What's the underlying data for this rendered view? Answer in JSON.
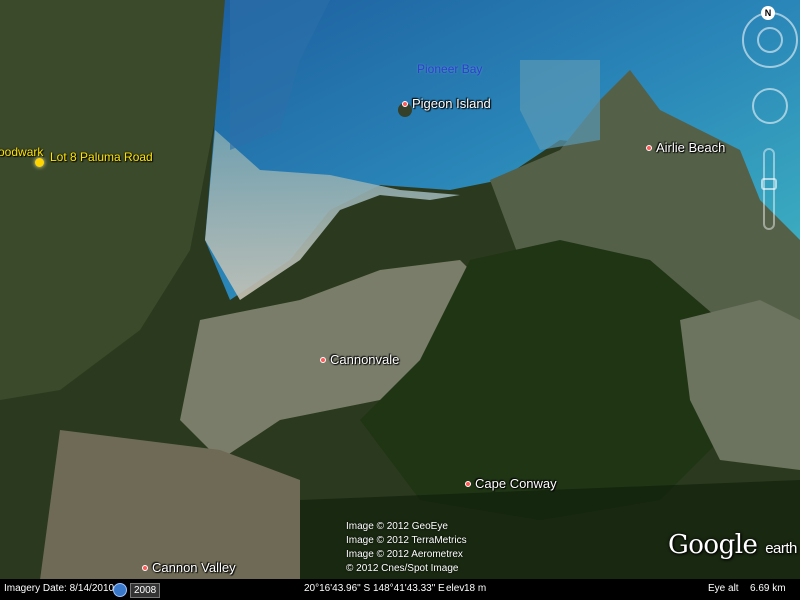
{
  "places": {
    "pioneer_bay": "Pioneer Bay",
    "pigeon_island": "Pigeon Island",
    "airlie_beach": "Airlie Beach",
    "cannonvale": "Cannonvale",
    "cape_conway": "Cape Conway",
    "cannon_valley": "Cannon Valley",
    "woodwark": "oodwark",
    "lot8": "Lot 8 Paluma Road"
  },
  "credits": [
    "Image © 2012 GeoEye",
    "Image © 2012 TerraMetrics",
    "Image © 2012 Aerometrex",
    "© 2012 Cnes/Spot Image"
  ],
  "logo": {
    "word1": "Google",
    "word2": "earth"
  },
  "status": {
    "imagery_date": "Imagery Date: 8/14/2010",
    "history_year": "2008",
    "coordinates": "20°16'43.96\" S 148°41'43.33\" E",
    "elev_label": "elev",
    "elev_value": "18 m",
    "eye_alt_label": "Eye alt",
    "eye_alt_value": "6.69 km"
  },
  "nav": {
    "north_label": "N"
  },
  "colors": {
    "place_dot": "#ff5a5a",
    "pin": "#ffd400",
    "water_label": "#2b3fd0"
  },
  "icons": {
    "globe": "globe-icon",
    "compass": "compass-icon",
    "pin": "placemark-pin-icon"
  }
}
